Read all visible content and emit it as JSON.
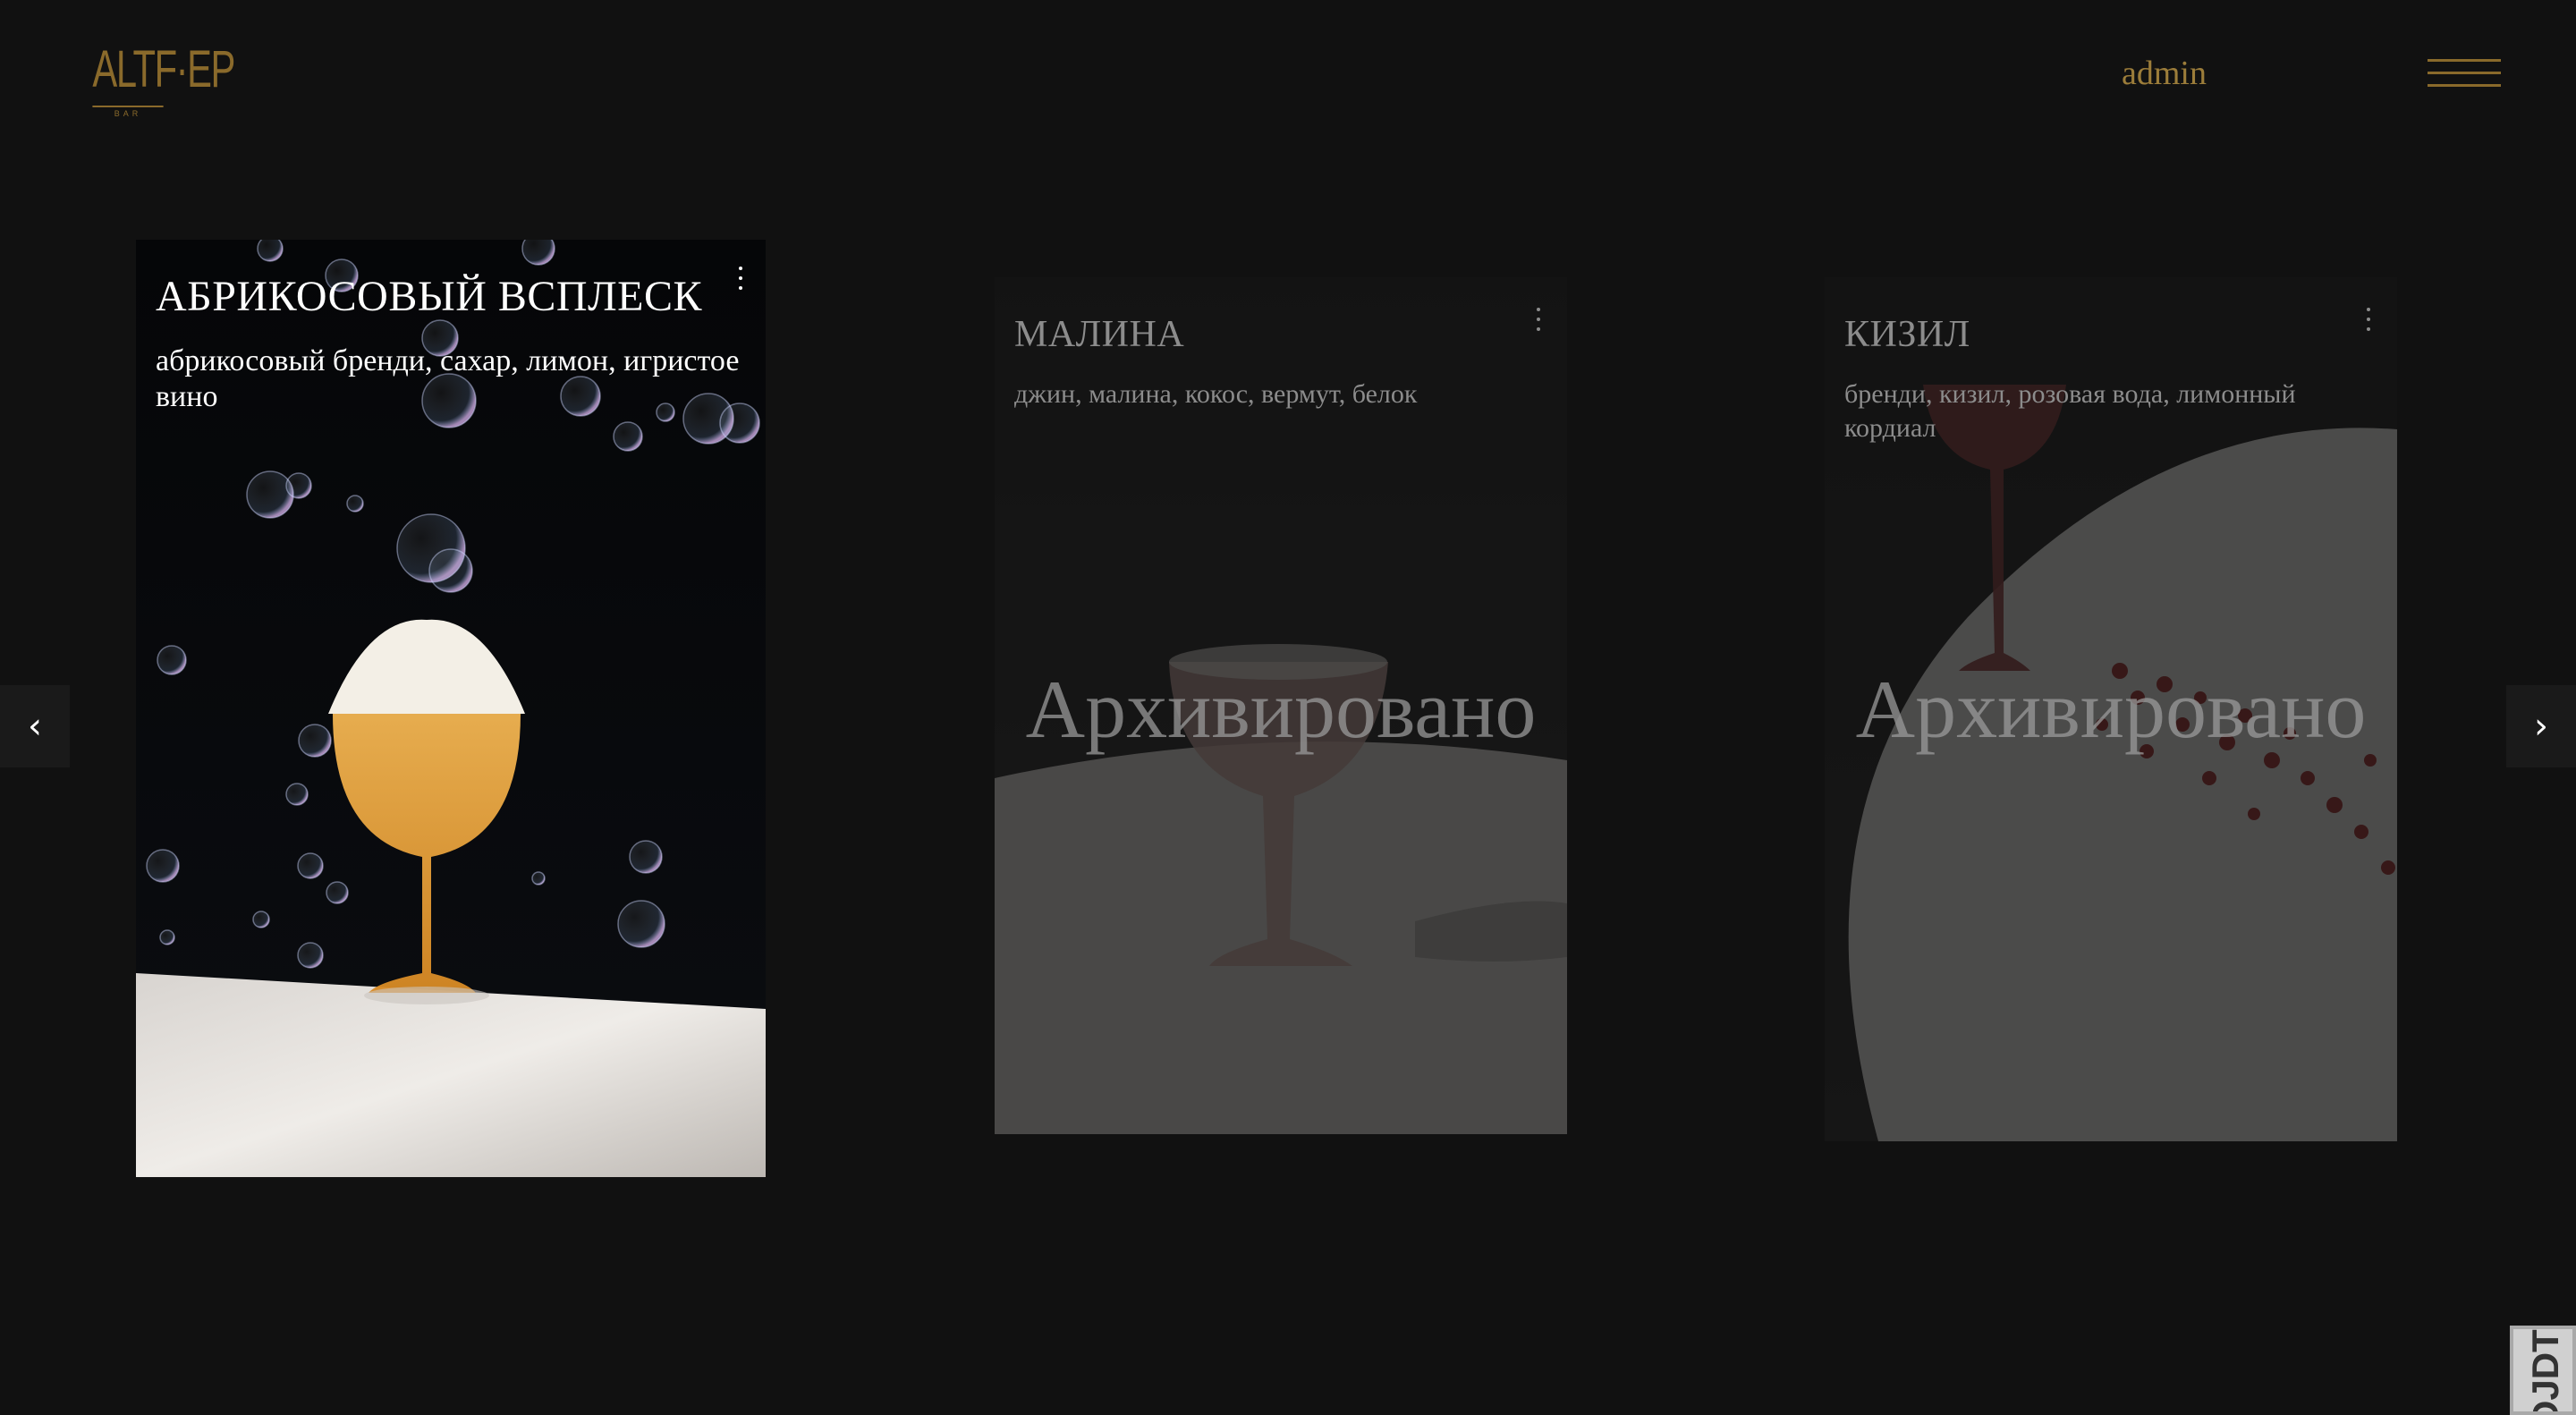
{
  "header": {
    "logo_text": "ALTF·EP",
    "logo_subtext": "BAR",
    "admin_label": "admin",
    "menu_icon": "hamburger-menu-icon"
  },
  "carousel": {
    "prev_label": "‹",
    "next_label": "›",
    "cards": [
      {
        "title": "АБРИКОСОВЫЙ ВСПЛЕСК",
        "description": "абрикосовый бренди, сахар, лимон, игристое вино",
        "archived": false
      },
      {
        "title": "МАЛИНА",
        "description": "джин, малина, кокос, вермут, белок",
        "archived": true,
        "archived_label": "Архивировано"
      },
      {
        "title": "КИЗИЛ",
        "description": "бренди, кизил, розовая вода, лимонный кордиал",
        "archived": true,
        "archived_label": "Архивировано"
      }
    ]
  },
  "devtools_tab": {
    "label": "DJDT"
  },
  "colors": {
    "background": "#111111",
    "accent_gold": "#9c7d3a",
    "muted_text": "#8c8c8c"
  }
}
